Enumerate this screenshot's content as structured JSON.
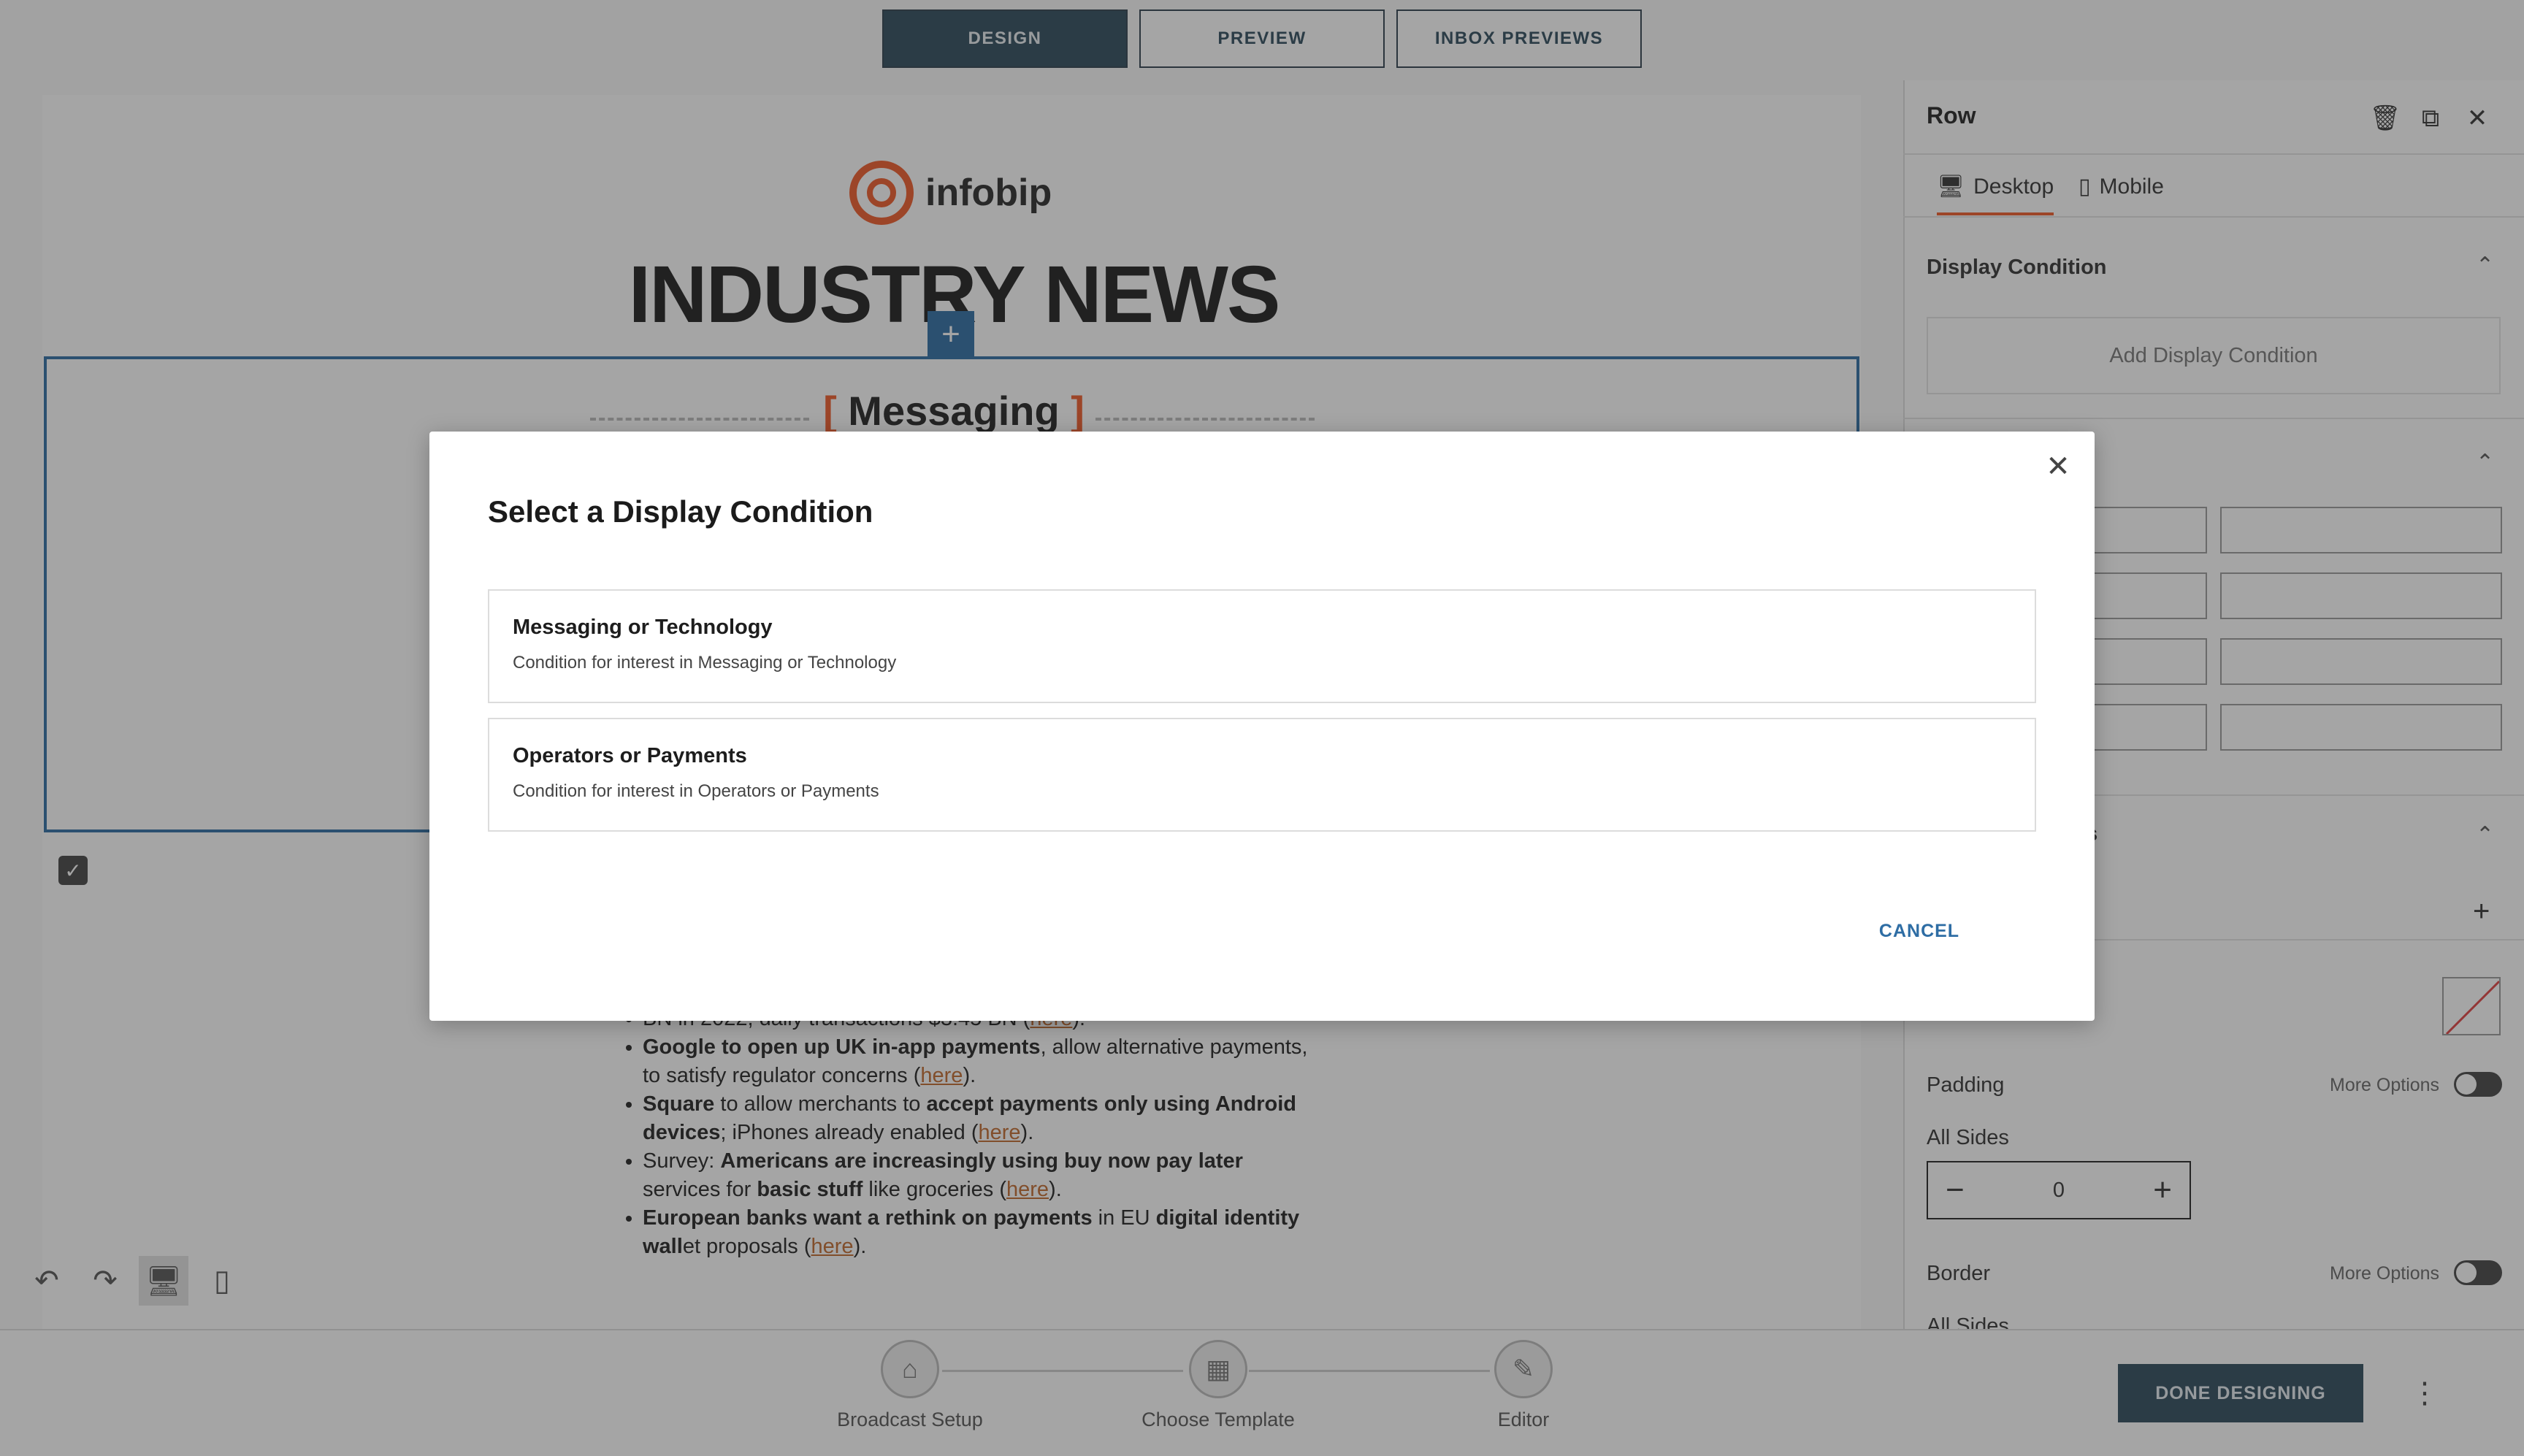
{
  "top_tabs": [
    {
      "label": "DESIGN",
      "active": true
    },
    {
      "label": "PREVIEW",
      "active": false
    },
    {
      "label": "INBOX PREVIEWS",
      "active": false
    }
  ],
  "email": {
    "logo_text": "infobip",
    "headline": "INDUSTRY NEWS",
    "section_label": "Messaging",
    "bullets": [
      {
        "parts": [
          [
            "",
            "BN in 2022, daily transactions $3.45 BN ("
          ],
          [
            "link",
            "here"
          ],
          [
            "",
            ")."
          ]
        ]
      },
      {
        "parts": [
          [
            "b",
            "Google to open up UK in-app payments"
          ],
          [
            "",
            ", allow alternative payments, to satisfy regulator concerns ("
          ],
          [
            "link",
            "here"
          ],
          [
            "",
            ")."
          ]
        ]
      },
      {
        "parts": [
          [
            "b",
            "Square"
          ],
          [
            "",
            " to allow merchants to "
          ],
          [
            "b",
            "accept payments only using Android devices"
          ],
          [
            "",
            "; iPhones already enabled ("
          ],
          [
            "link",
            "here"
          ],
          [
            "",
            ")."
          ]
        ]
      },
      {
        "parts": [
          [
            "",
            "Survey: "
          ],
          [
            "b",
            "Americans are increasingly using buy now pay later"
          ],
          [
            "",
            " services for "
          ],
          [
            "b",
            "basic stuff"
          ],
          [
            "",
            " like groceries ("
          ],
          [
            "link",
            "here"
          ],
          [
            "",
            ")."
          ]
        ]
      },
      {
        "parts": [
          [
            "b",
            "European banks want a rethink on payments"
          ],
          [
            "",
            " in EU "
          ],
          [
            "b",
            "digital identity wall"
          ],
          [
            "",
            "et proposals ("
          ],
          [
            "link",
            "here"
          ],
          [
            "",
            ")."
          ]
        ]
      }
    ]
  },
  "stepper": {
    "steps": [
      {
        "label": "Broadcast Setup"
      },
      {
        "label": "Choose Template"
      },
      {
        "label": "Editor"
      }
    ],
    "done_label": "DONE DESIGNING",
    "kebab": "⋮"
  },
  "panel": {
    "title": "Row",
    "device_tabs": [
      {
        "label": "Desktop",
        "active": true
      },
      {
        "label": "Mobile",
        "active": false
      }
    ],
    "display_condition_title": "Display Condition",
    "add_condition_label": "Add Display Condition",
    "partial_section_suffix": "es",
    "padding_label": "Padding",
    "more_options": "More Options",
    "all_sides_label": "All Sides",
    "padding_value": "0",
    "border_label": "Border",
    "all_sides_partial": "All Sides"
  },
  "modal": {
    "title": "Select a Display Condition",
    "options": [
      {
        "title": "Messaging or Technology",
        "description": "Condition for interest in Messaging or Technology"
      },
      {
        "title": "Operators or Payments",
        "description": "Condition for interest in Operators or Payments"
      }
    ],
    "cancel_label": "CANCEL"
  },
  "colors": {
    "accent": "#2e4a5c",
    "brand_orange": "#f05a28",
    "link_blue": "#2e6da4"
  },
  "icons": {
    "close": "close-icon",
    "trash": "trash-icon",
    "duplicate": "duplicate-icon",
    "undo": "undo-icon",
    "redo": "redo-icon",
    "desktop": "desktop-icon",
    "mobile": "mobile-icon"
  }
}
